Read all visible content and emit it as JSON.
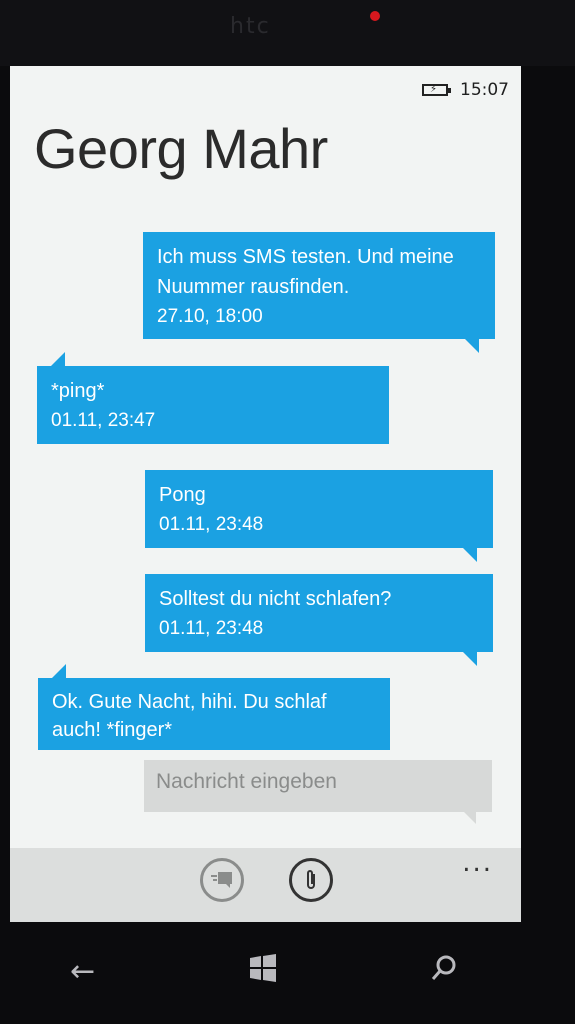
{
  "device": {
    "brand": "htc"
  },
  "status": {
    "time": "15:07",
    "battery_icon": "battery-charging-icon"
  },
  "conversation": {
    "title": "Georg Mahr"
  },
  "messages": [
    {
      "text": "Ich muss SMS testen. Und meine Nuummer rausfinden.",
      "time": "27.10, 18:00",
      "direction": "outgoing"
    },
    {
      "text": "*ping*",
      "time": "01.11, 23:47",
      "direction": "incoming"
    },
    {
      "text": "Pong",
      "time": "01.11, 23:48",
      "direction": "outgoing"
    },
    {
      "text": "Solltest du nicht schlafen?",
      "time": "01.11, 23:48",
      "direction": "outgoing"
    },
    {
      "text": "Ok. Gute Nacht, hihi. Du schlaf auch! *finger*",
      "time": "",
      "direction": "incoming"
    }
  ],
  "compose": {
    "placeholder": "Nachricht eingeben"
  },
  "appbar": {
    "send_icon": "send-icon",
    "attach_icon": "attach-icon",
    "more": "..."
  },
  "colors": {
    "accent": "#1ba1e2",
    "background": "#f2f4f3"
  }
}
